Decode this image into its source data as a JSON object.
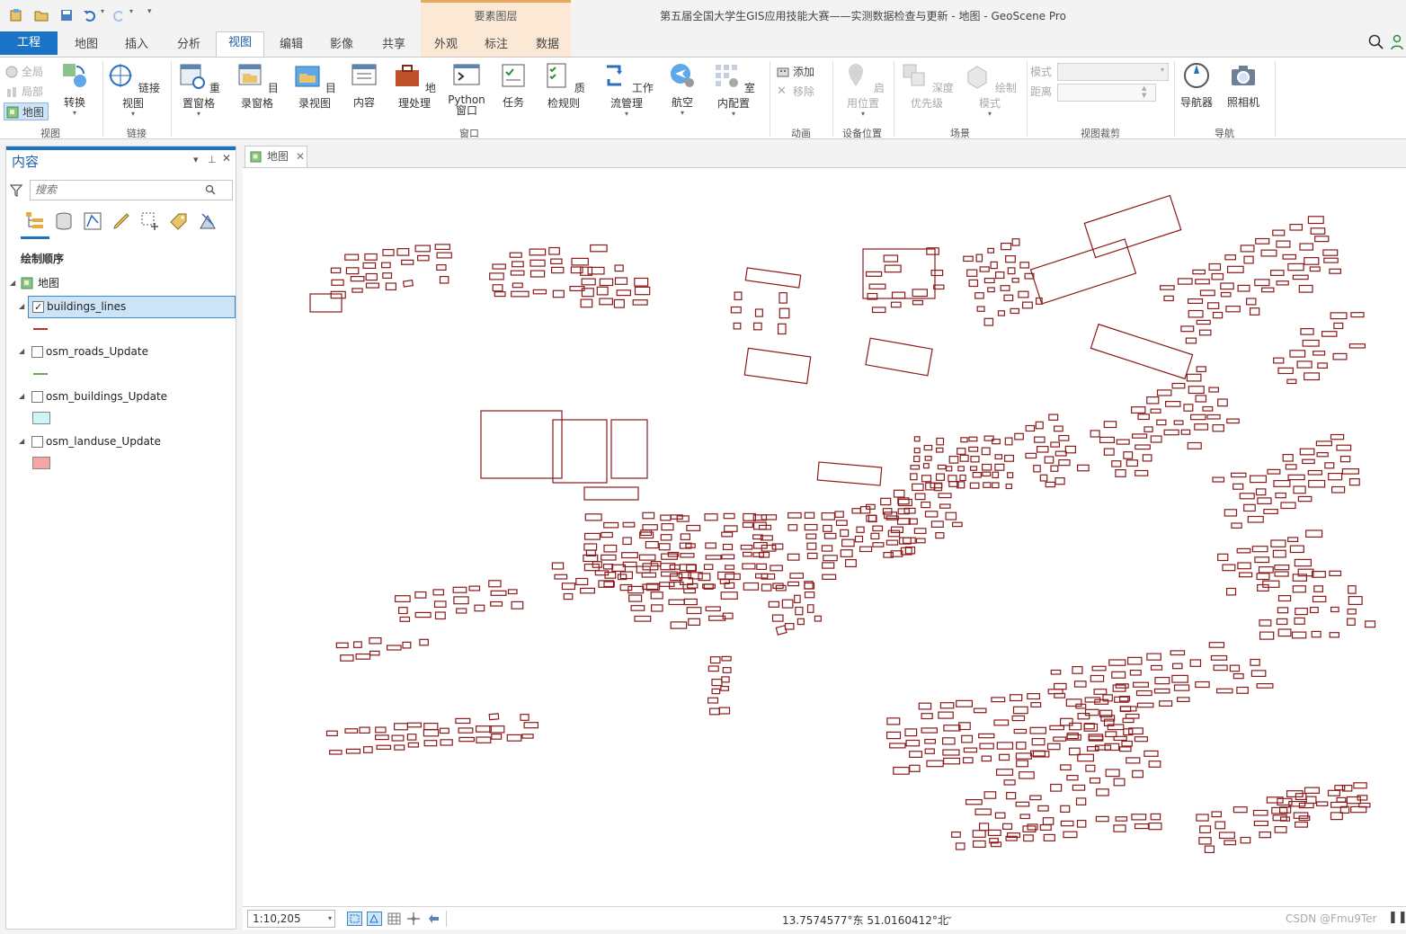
{
  "window": {
    "title": "第五届全国大学生GIS应用技能大赛——实测数据检查与更新 - 地图 - GeoScene Pro",
    "context_tab_group": "要素图层"
  },
  "tabs": [
    {
      "label": "工程",
      "kind": "project"
    },
    {
      "label": "地图"
    },
    {
      "label": "插入"
    },
    {
      "label": "分析"
    },
    {
      "label": "视图",
      "active": true
    },
    {
      "label": "编辑"
    },
    {
      "label": "影像"
    },
    {
      "label": "共享"
    },
    {
      "label": "外观"
    },
    {
      "label": "标注"
    },
    {
      "label": "数据"
    }
  ],
  "ribbon": {
    "view_group": {
      "label": "视图",
      "full": "全局",
      "local": "局部",
      "map": "地图",
      "convert": "转换"
    },
    "link_group": {
      "label": "链接",
      "link_views": "链接视图"
    },
    "window_group": {
      "label": "窗口",
      "buttons": [
        "重置窗格",
        "目录窗格",
        "目录视图",
        "内容",
        "地理处理",
        "Python 窗口",
        "任务",
        "质检规则",
        "工作流管理",
        "航空",
        "室内配置"
      ]
    },
    "animation_group": {
      "label": "动画",
      "add": "添加",
      "remove": "移除"
    },
    "device_group": {
      "label": "设备位置",
      "enable": "启用位置"
    },
    "scene_group": {
      "label": "场景",
      "depth_priority": "深度优先级",
      "draw_mode": "绘制模式"
    },
    "clip_group": {
      "label": "视图裁剪",
      "mode_label": "模式",
      "distance_label": "距离"
    },
    "nav_group": {
      "label": "导航",
      "navigator": "导航器",
      "camera": "照相机"
    }
  },
  "contents": {
    "title": "内容",
    "search_placeholder": "搜索",
    "section": "绘制顺序",
    "map_name": "地图",
    "layers": [
      {
        "name": "buildings_lines",
        "checked": true,
        "selected": true,
        "symbol": "line",
        "color": "#b83232"
      },
      {
        "name": "osm_roads_Update",
        "checked": false,
        "symbol": "line",
        "color": "#6aa84f"
      },
      {
        "name": "osm_buildings_Update",
        "checked": false,
        "symbol": "fill",
        "color": "#ccf5f5"
      },
      {
        "name": "osm_landuse_Update",
        "checked": false,
        "symbol": "fill",
        "color": "#f4a6a6"
      }
    ]
  },
  "map_view": {
    "tab_label": "地图",
    "building_color": "#8b1a1a"
  },
  "statusbar": {
    "scale": "1:10,205",
    "coordinates": "13.7574577°东 51.0160412°北",
    "watermark": "CSDN @Fmu9Ter"
  }
}
